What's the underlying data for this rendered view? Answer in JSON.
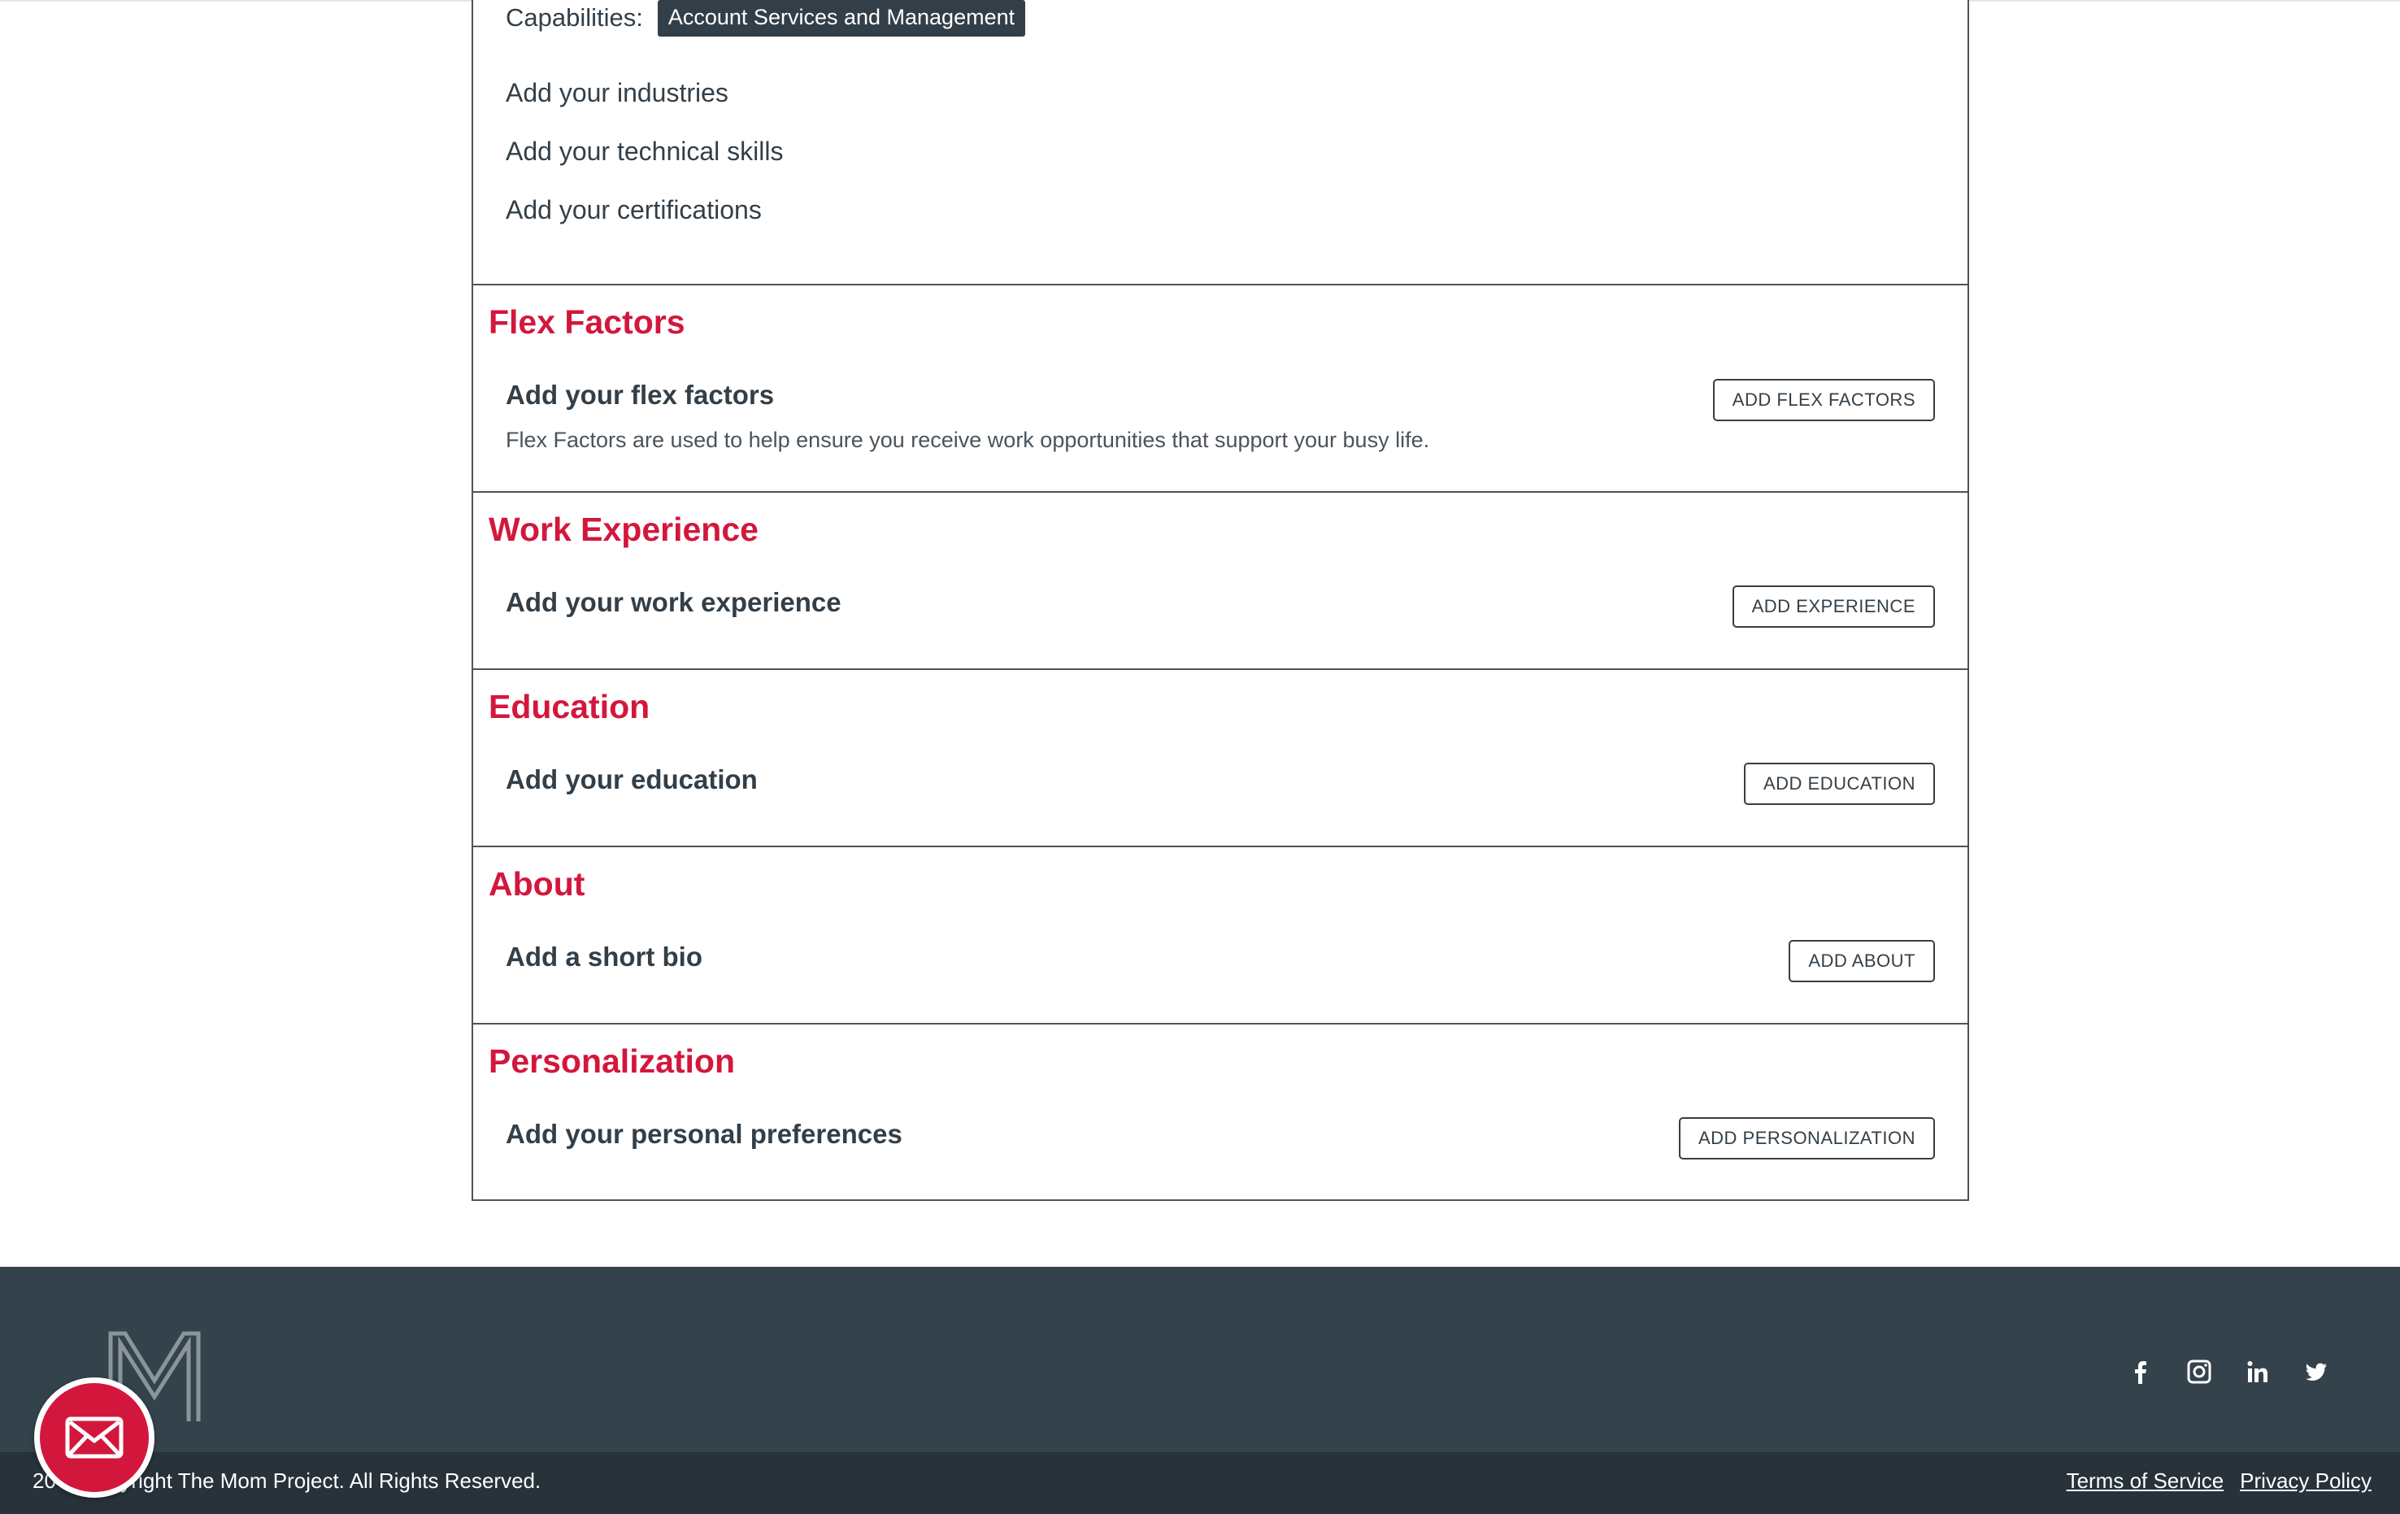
{
  "skills": {
    "capabilities_label": "Capabilities:",
    "capability_chip": "Account Services and Management",
    "add_industries": "Add your industries",
    "add_technical_skills": "Add your technical skills",
    "add_certifications": "Add your certifications"
  },
  "sections": {
    "flex": {
      "title": "Flex Factors",
      "prompt": "Add your flex factors",
      "help": "Flex Factors are used to help ensure you receive work opportunities that support your busy life.",
      "button": "ADD FLEX FACTORS"
    },
    "work": {
      "title": "Work Experience",
      "prompt": "Add your work experience",
      "button": "ADD EXPERIENCE"
    },
    "education": {
      "title": "Education",
      "prompt": "Add your education",
      "button": "ADD EDUCATION"
    },
    "about": {
      "title": "About",
      "prompt": "Add a short bio",
      "button": "ADD ABOUT"
    },
    "personalization": {
      "title": "Personalization",
      "prompt": "Add your personal preferences",
      "button": "ADD PERSONALIZATION"
    }
  },
  "footer": {
    "copyright": "20       opyright The Mom Project. All Rights Reserved.",
    "terms": "Terms of Service",
    "privacy": "Privacy Policy",
    "social_icons": [
      "facebook-icon",
      "instagram-icon",
      "linkedin-icon",
      "twitter-icon"
    ]
  },
  "colors": {
    "accent": "#d3173c",
    "text": "#333f48",
    "footer": "#34424c",
    "footer_bottom": "#27323a"
  }
}
